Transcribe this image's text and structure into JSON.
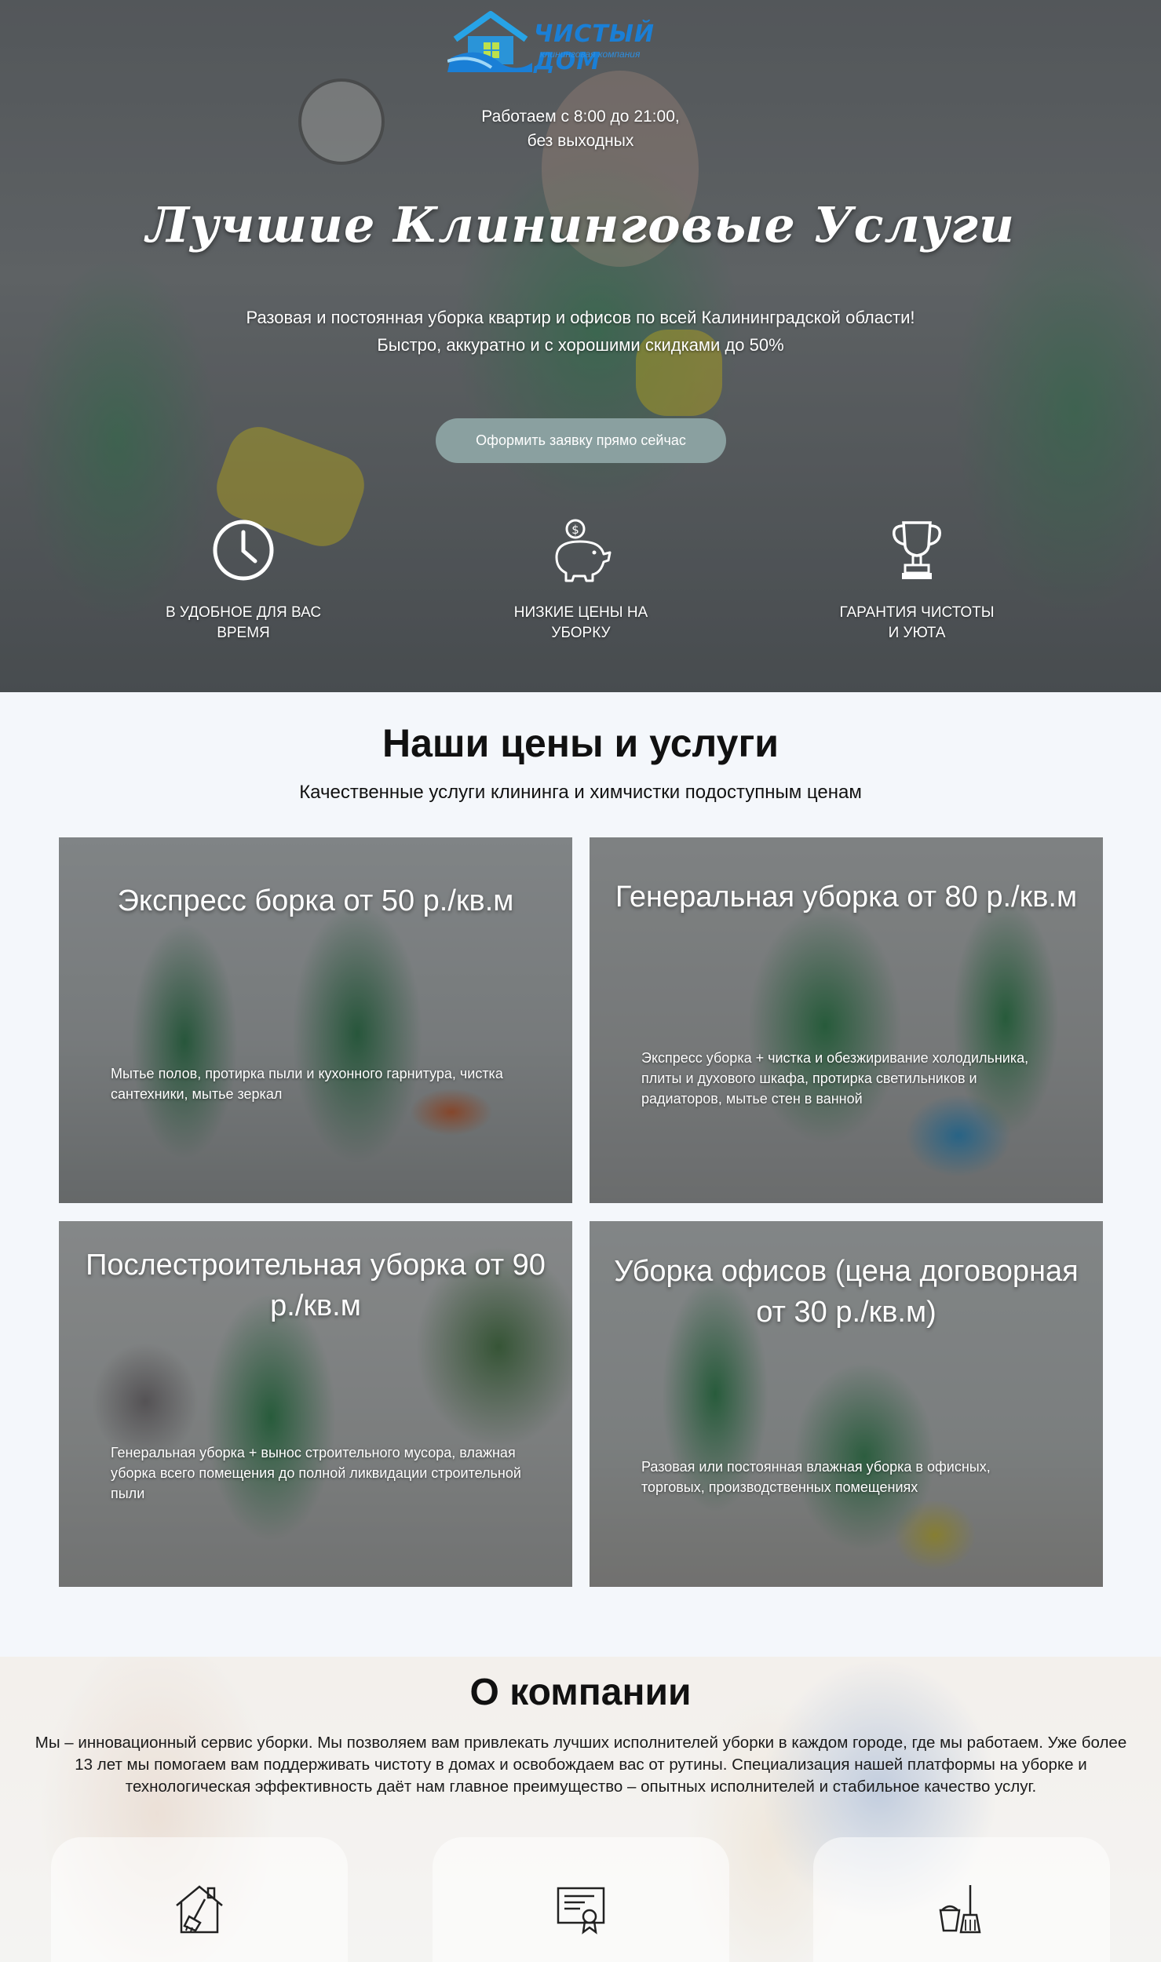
{
  "brand": {
    "name": "ЧИСТЫЙ ДОМ",
    "tagline": "клининговая компания",
    "colors": {
      "primary": "#1a7fd6",
      "accent_green": "#2f9a4a"
    }
  },
  "hero": {
    "hours_line1": "Работаем с 8:00 до 21:00,",
    "hours_line2": "без выходных",
    "title": "Лучшие Клининговые Услуги",
    "subtitle_line1": "Разовая и постоянная уборка квартир и офисов по всей Калининградской области!",
    "subtitle_line2": "Быстро, аккуратно и с хорошими скидками до 50%",
    "cta_label": "Оформить заявку прямо сейчас",
    "features": [
      {
        "icon": "clock-icon",
        "label": "В удобное для вас\nвремя"
      },
      {
        "icon": "piggy-bank-icon",
        "label": "Низкие цены на\nуборку"
      },
      {
        "icon": "trophy-icon",
        "label": "Гарантия чистоты\nи уюта"
      }
    ]
  },
  "prices": {
    "title": "Наши цены и услуги",
    "subtitle": "Качественные услуги клининга и химчистки подоступным ценам",
    "cards": [
      {
        "title": "Экспресс борка от 50 р./кв.м",
        "description": "Мытье полов, протирка пыли и кухонного гарнитура, чистка сантехники, мытье зеркал"
      },
      {
        "title": "Генеральная уборка от 80 р./кв.м",
        "description": "Экспресс уборка + чистка и обезжиривание холодильника, плиты и духового шкафа, протирка светильников и радиаторов, мытье стен в ванной"
      },
      {
        "title": "Послестроительная уборка от 90 р./кв.м",
        "description": "Генеральная уборка + вынос строительного мусора, влажная уборка всего помещения до полной ликвидации строительной пыли"
      },
      {
        "title": "Уборка офисов (цена договорная от 30 р./кв.м)",
        "description": "Разовая или постоянная влажная уборка в офисных, торговых, производственных помещениях"
      }
    ]
  },
  "about": {
    "title": "О компании",
    "text": "Мы – инновационный сервис уборки. Мы позволяем вам привлекать лучших исполнителей уборки в каждом городе, где мы работаем. Уже более 13 лет мы помогаем вам поддерживать чистоту в домах и освобождаем вас от рутины. Специализация нашей платформы на уборке и технологическая эффективность даёт нам главное преимущество – опытных исполнителей и стабильное качество услуг.",
    "cards": [
      {
        "icon": "house-cleaning-icon"
      },
      {
        "icon": "certificate-icon"
      },
      {
        "icon": "broom-bucket-icon"
      }
    ]
  }
}
